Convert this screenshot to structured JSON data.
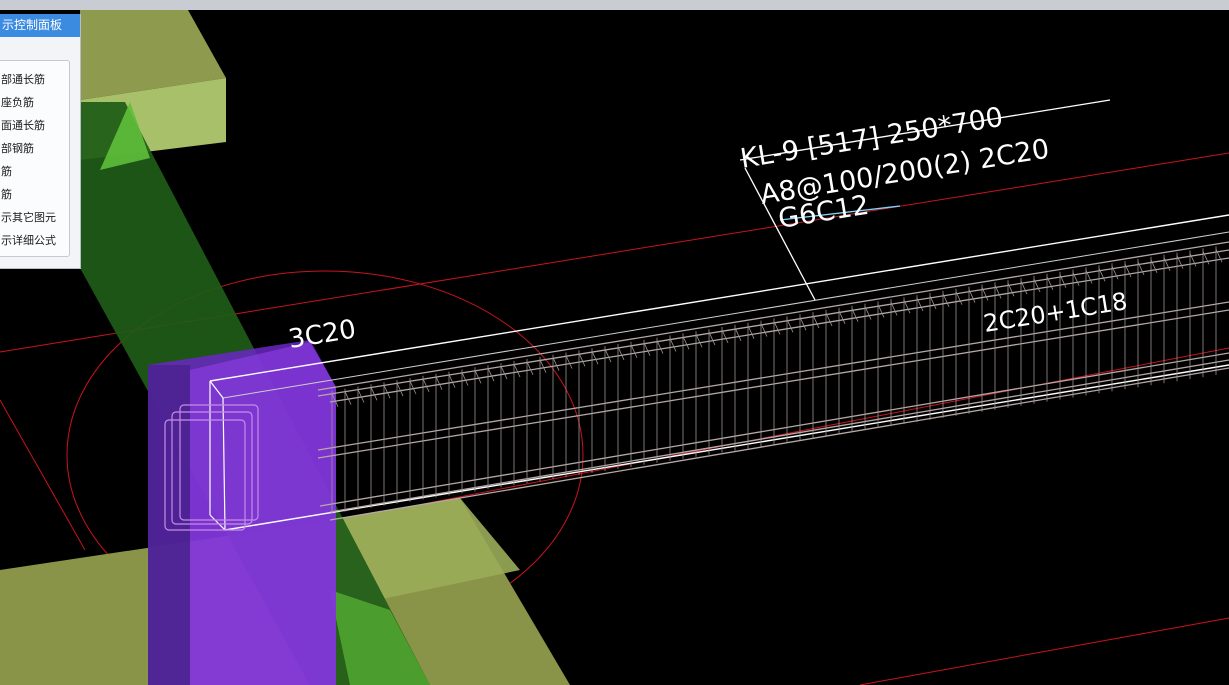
{
  "panel": {
    "title": "示控制面板",
    "items": [
      {
        "label": "部通长筋"
      },
      {
        "label": "座负筋"
      },
      {
        "label": "面通长筋"
      },
      {
        "label": "部钢筋"
      },
      {
        "label": "筋"
      },
      {
        "label": "筋"
      },
      {
        "label": "示其它图元"
      },
      {
        "label": "示详细公式"
      }
    ]
  },
  "annotations": {
    "beam_line1": "KL-9 [517] 250*700",
    "beam_line2": "A8@100/200(2) 2C20",
    "beam_line3": "G6C12",
    "support_rebar": "3C20",
    "span_rebar": "2C20+1C18"
  },
  "colors": {
    "background": "#000000",
    "slab": "#a9c06a",
    "column": "#7b2fd6",
    "diagonal_member": "#3a9d2a",
    "rebar": "#b5a8a6",
    "annotation_text": "#ffffff",
    "grid_line": "#c8141e",
    "panel_header": "#3b8be0"
  }
}
